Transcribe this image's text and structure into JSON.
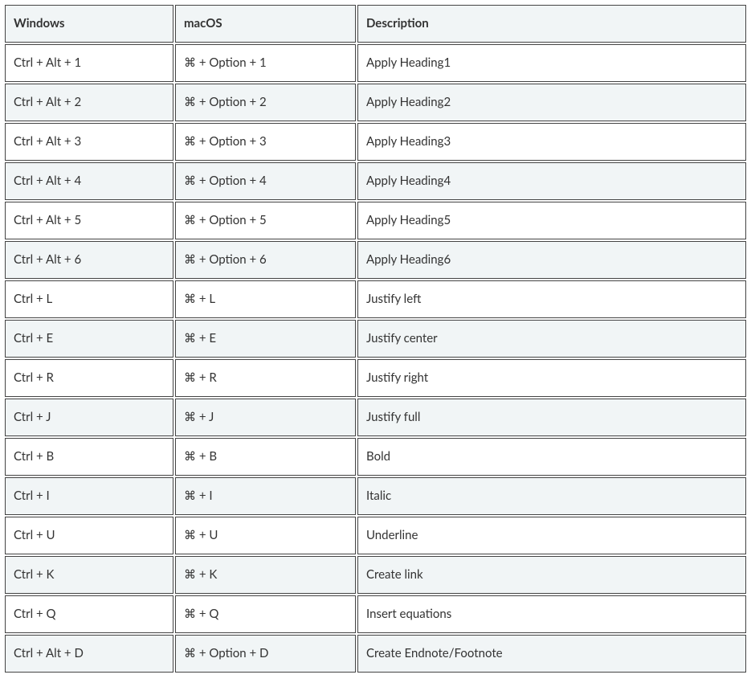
{
  "table": {
    "headers": {
      "windows": "Windows",
      "macos": "macOS",
      "description": "Description"
    },
    "rows": [
      {
        "windows": "Ctrl + Alt + 1",
        "macos": "⌘ + Option + 1",
        "description": "Apply Heading1"
      },
      {
        "windows": "Ctrl + Alt + 2",
        "macos": "⌘ + Option + 2",
        "description": "Apply Heading2"
      },
      {
        "windows": "Ctrl + Alt + 3",
        "macos": "⌘ + Option + 3",
        "description": "Apply Heading3"
      },
      {
        "windows": "Ctrl + Alt + 4",
        "macos": "⌘ + Option + 4",
        "description": "Apply Heading4"
      },
      {
        "windows": "Ctrl + Alt + 5",
        "macos": "⌘ + Option + 5",
        "description": "Apply Heading5"
      },
      {
        "windows": "Ctrl + Alt + 6",
        "macos": "⌘ + Option + 6",
        "description": "Apply Heading6"
      },
      {
        "windows": "Ctrl + L",
        "macos": "⌘ + L",
        "description": "Justify left"
      },
      {
        "windows": "Ctrl + E",
        "macos": "⌘ + E",
        "description": "Justify center"
      },
      {
        "windows": "Ctrl + R",
        "macos": "⌘ + R",
        "description": "Justify right"
      },
      {
        "windows": "Ctrl + J",
        "macos": "⌘ + J",
        "description": "Justify full"
      },
      {
        "windows": "Ctrl + B",
        "macos": "⌘ + B",
        "description": "Bold"
      },
      {
        "windows": "Ctrl + I",
        "macos": "⌘ + I",
        "description": "Italic"
      },
      {
        "windows": "Ctrl + U",
        "macos": "⌘ + U",
        "description": "Underline"
      },
      {
        "windows": "Ctrl + K",
        "macos": "⌘ + K",
        "description": "Create link"
      },
      {
        "windows": "Ctrl + Q",
        "macos": "⌘ + Q",
        "description": "Insert equations"
      },
      {
        "windows": "Ctrl + Alt + D",
        "macos": "⌘ + Option + D",
        "description": "Create Endnote/Footnote"
      }
    ]
  }
}
